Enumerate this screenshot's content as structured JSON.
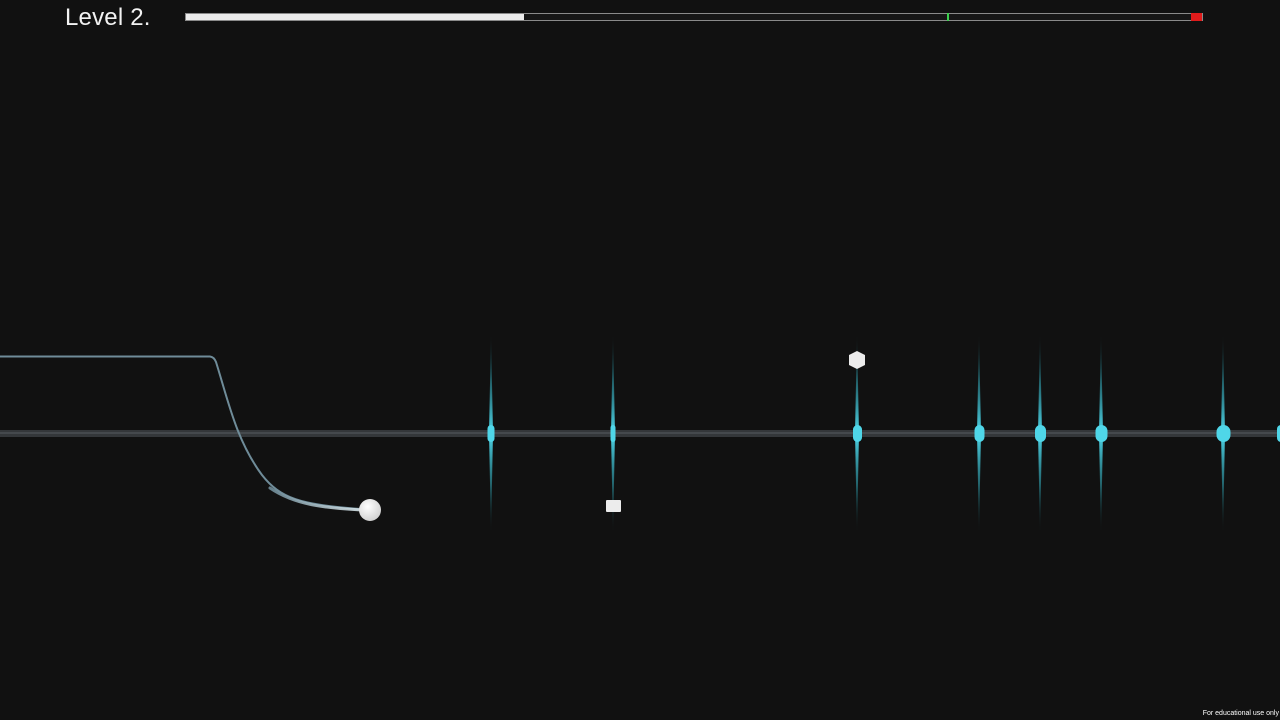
{
  "hud": {
    "level_label": "Level 2.",
    "progress": 0.333,
    "checkpoint": 0.749
  },
  "colors": {
    "background": "#111111",
    "track": "#3a3d40",
    "beat": "#4fd6e8",
    "beat_glow": "#1fa3b5",
    "trail": "#6f8c99",
    "player": "#f0f0f0",
    "progress_fill": "#ececec",
    "checkpoint": "#3ccf4e",
    "goal": "#e01b1b"
  },
  "watermark": "For educational use only"
}
